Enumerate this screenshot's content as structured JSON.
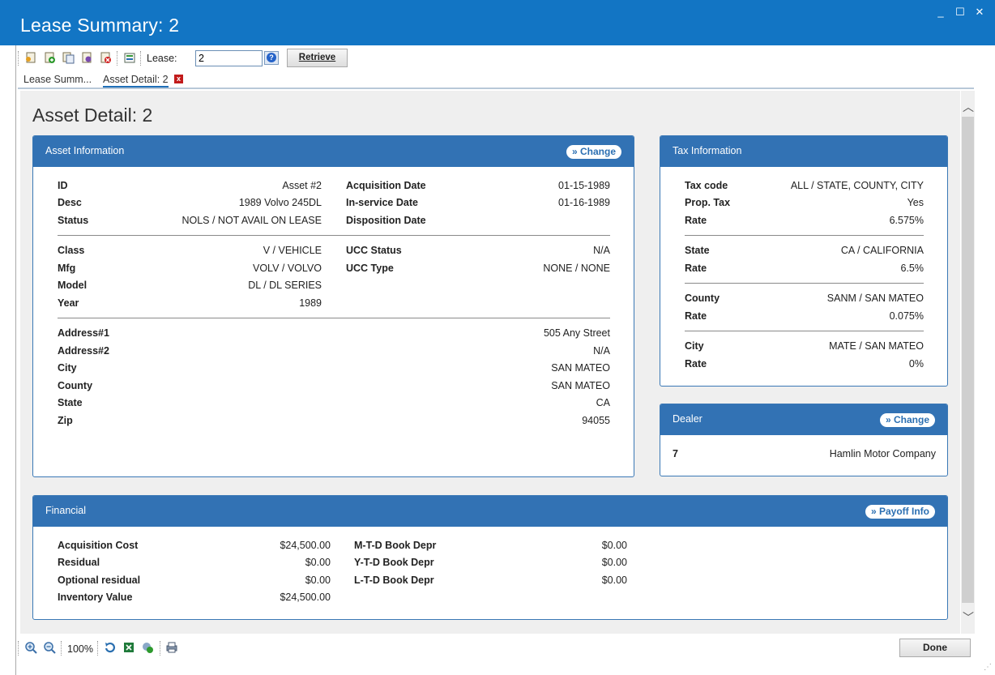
{
  "window": {
    "title": "Lease Summary: 2",
    "minimize": "_",
    "maximize": "☐",
    "close": "✕"
  },
  "toolbar": {
    "lease_label": "Lease:",
    "lease_value": "2",
    "retrieve_label": "Retrieve"
  },
  "tabs": [
    {
      "label": "Lease Summ..."
    },
    {
      "label": "Asset Detail: 2",
      "close": "x"
    }
  ],
  "page_title": "Asset Detail: 2",
  "asset": {
    "title": "Asset Information",
    "change_label": "» Change",
    "left": [
      {
        "k": "ID",
        "v": "Asset #2"
      },
      {
        "k": "Desc",
        "v": "1989 Volvo 245DL"
      },
      {
        "k": "Status",
        "v": "NOLS / NOT AVAIL ON LEASE"
      },
      {
        "k": "Class",
        "v": "V / VEHICLE"
      },
      {
        "k": "Mfg",
        "v": "VOLV / VOLVO"
      },
      {
        "k": "Model",
        "v": "DL / DL SERIES"
      },
      {
        "k": "Year",
        "v": "1989"
      }
    ],
    "right": [
      {
        "k": "Acquisition Date",
        "v": "01-15-1989"
      },
      {
        "k": "In-service Date",
        "v": "01-16-1989"
      },
      {
        "k": "Disposition Date",
        "v": ""
      },
      {
        "k": "UCC Status",
        "v": "N/A"
      },
      {
        "k": "UCC Type",
        "v": "NONE / NONE"
      }
    ],
    "address": [
      {
        "k": "Address#1",
        "v": "505 Any Street"
      },
      {
        "k": "Address#2",
        "v": "N/A"
      },
      {
        "k": "City",
        "v": "SAN MATEO"
      },
      {
        "k": "County",
        "v": "SAN MATEO"
      },
      {
        "k": "State",
        "v": "CA"
      },
      {
        "k": "Zip",
        "v": "94055"
      }
    ]
  },
  "tax": {
    "title": "Tax Information",
    "rows": [
      {
        "k": "Tax code",
        "v": "ALL / STATE, COUNTY, CITY"
      },
      {
        "k": "Prop. Tax",
        "v": "Yes"
      },
      {
        "k": "Rate",
        "v": "6.575%"
      },
      {
        "k": "State",
        "v": "CA / CALIFORNIA"
      },
      {
        "k": "Rate",
        "v": "6.5%"
      },
      {
        "k": "County",
        "v": "SANM / SAN MATEO"
      },
      {
        "k": "Rate",
        "v": "0.075%"
      },
      {
        "k": "City",
        "v": "MATE / SAN MATEO"
      },
      {
        "k": "Rate",
        "v": "0%"
      }
    ]
  },
  "dealer": {
    "title": "Dealer",
    "change_label": "» Change",
    "id": "7",
    "name": "Hamlin Motor Company"
  },
  "financial": {
    "title": "Financial",
    "payoff_label": "» Payoff Info",
    "left": [
      {
        "k": "Acquisition Cost",
        "v": "$24,500.00"
      },
      {
        "k": "Residual",
        "v": "$0.00"
      },
      {
        "k": "Optional residual",
        "v": "$0.00"
      },
      {
        "k": "Inventory Value",
        "v": "$24,500.00"
      }
    ],
    "right": [
      {
        "k": "M-T-D Book Depr",
        "v": "$0.00"
      },
      {
        "k": "Y-T-D Book Depr",
        "v": "$0.00"
      },
      {
        "k": "L-T-D Book Depr",
        "v": "$0.00"
      }
    ]
  },
  "statusbar": {
    "zoom": "100%",
    "done_label": "Done"
  }
}
